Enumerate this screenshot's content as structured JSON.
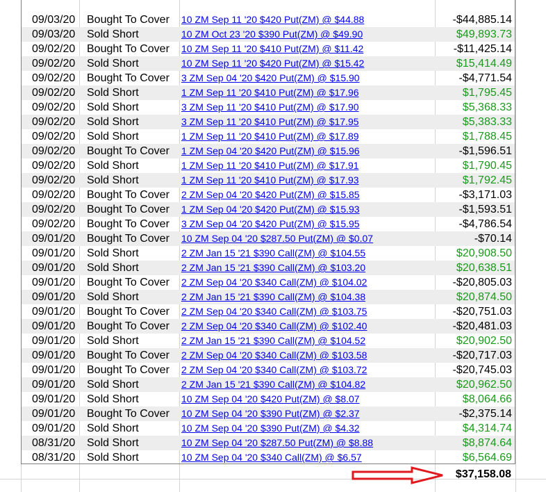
{
  "colors": {
    "positive": "#1a9a1a",
    "negative": "#000000",
    "link": "#0000ee",
    "arrow": "#e0191f"
  },
  "rows": [
    {
      "date": "09/03/20",
      "action": "Bought To Cover",
      "desc": "10 ZM Sep 11 '20 $420 Put(ZM) @ $44.88",
      "amount": "-$44,885.14",
      "positive": false
    },
    {
      "date": "09/03/20",
      "action": "Sold Short",
      "desc": "10 ZM Oct 23 '20 $390 Put(ZM) @ $49.90",
      "amount": "$49,893.73",
      "positive": true
    },
    {
      "date": "09/02/20",
      "action": "Bought To Cover",
      "desc": "10 ZM Sep 11 '20 $410 Put(ZM) @ $11.42",
      "amount": "-$11,425.14",
      "positive": false
    },
    {
      "date": "09/02/20",
      "action": "Sold Short",
      "desc": "10 ZM Sep 11 '20 $420 Put(ZM) @ $15.42",
      "amount": "$15,414.49",
      "positive": true
    },
    {
      "date": "09/02/20",
      "action": "Bought To Cover",
      "desc": "3 ZM Sep 04 '20 $420 Put(ZM) @ $15.90",
      "amount": "-$4,771.54",
      "positive": false
    },
    {
      "date": "09/02/20",
      "action": "Sold Short",
      "desc": "1 ZM Sep 11 '20 $410 Put(ZM) @ $17.96",
      "amount": "$1,795.45",
      "positive": true
    },
    {
      "date": "09/02/20",
      "action": "Sold Short",
      "desc": "3 ZM Sep 11 '20 $410 Put(ZM) @ $17.90",
      "amount": "$5,368.33",
      "positive": true
    },
    {
      "date": "09/02/20",
      "action": "Sold Short",
      "desc": "3 ZM Sep 11 '20 $410 Put(ZM) @ $17.95",
      "amount": "$5,383.33",
      "positive": true
    },
    {
      "date": "09/02/20",
      "action": "Sold Short",
      "desc": "1 ZM Sep 11 '20 $410 Put(ZM) @ $17.89",
      "amount": "$1,788.45",
      "positive": true
    },
    {
      "date": "09/02/20",
      "action": "Bought To Cover",
      "desc": "1 ZM Sep 04 '20 $420 Put(ZM) @ $15.96",
      "amount": "-$1,596.51",
      "positive": false
    },
    {
      "date": "09/02/20",
      "action": "Sold Short",
      "desc": "1 ZM Sep 11 '20 $410 Put(ZM) @ $17.91",
      "amount": "$1,790.45",
      "positive": true
    },
    {
      "date": "09/02/20",
      "action": "Sold Short",
      "desc": "1 ZM Sep 11 '20 $410 Put(ZM) @ $17.93",
      "amount": "$1,792.45",
      "positive": true
    },
    {
      "date": "09/02/20",
      "action": "Bought To Cover",
      "desc": "2 ZM Sep 04 '20 $420 Put(ZM) @ $15.85",
      "amount": "-$3,171.03",
      "positive": false
    },
    {
      "date": "09/02/20",
      "action": "Bought To Cover",
      "desc": "1 ZM Sep 04 '20 $420 Put(ZM) @ $15.93",
      "amount": "-$1,593.51",
      "positive": false
    },
    {
      "date": "09/02/20",
      "action": "Bought To Cover",
      "desc": "3 ZM Sep 04 '20 $420 Put(ZM) @ $15.95",
      "amount": "-$4,786.54",
      "positive": false
    },
    {
      "date": "09/01/20",
      "action": "Bought To Cover",
      "desc": "10 ZM Sep 04 '20 $287.50 Put(ZM) @ $0.07",
      "amount": "-$70.14",
      "positive": false
    },
    {
      "date": "09/01/20",
      "action": "Sold Short",
      "desc": "2 ZM Jan 15 '21 $390 Call(ZM) @ $104.55",
      "amount": "$20,908.50",
      "positive": true
    },
    {
      "date": "09/01/20",
      "action": "Sold Short",
      "desc": "2 ZM Jan 15 '21 $390 Call(ZM) @ $103.20",
      "amount": "$20,638.51",
      "positive": true
    },
    {
      "date": "09/01/20",
      "action": "Bought To Cover",
      "desc": "2 ZM Sep 04 '20 $340 Call(ZM) @ $104.02",
      "amount": "-$20,805.03",
      "positive": false
    },
    {
      "date": "09/01/20",
      "action": "Sold Short",
      "desc": "2 ZM Jan 15 '21 $390 Call(ZM) @ $104.38",
      "amount": "$20,874.50",
      "positive": true
    },
    {
      "date": "09/01/20",
      "action": "Bought To Cover",
      "desc": "2 ZM Sep 04 '20 $340 Call(ZM) @ $103.75",
      "amount": "-$20,751.03",
      "positive": false
    },
    {
      "date": "09/01/20",
      "action": "Bought To Cover",
      "desc": "2 ZM Sep 04 '20 $340 Call(ZM) @ $102.40",
      "amount": "-$20,481.03",
      "positive": false
    },
    {
      "date": "09/01/20",
      "action": "Sold Short",
      "desc": "2 ZM Jan 15 '21 $390 Call(ZM) @ $104.52",
      "amount": "$20,902.50",
      "positive": true
    },
    {
      "date": "09/01/20",
      "action": "Bought To Cover",
      "desc": "2 ZM Sep 04 '20 $340 Call(ZM) @ $103.58",
      "amount": "-$20,717.03",
      "positive": false
    },
    {
      "date": "09/01/20",
      "action": "Bought To Cover",
      "desc": "2 ZM Sep 04 '20 $340 Call(ZM) @ $103.72",
      "amount": "-$20,745.03",
      "positive": false
    },
    {
      "date": "09/01/20",
      "action": "Sold Short",
      "desc": "2 ZM Jan 15 '21 $390 Call(ZM) @ $104.82",
      "amount": "$20,962.50",
      "positive": true
    },
    {
      "date": "09/01/20",
      "action": "Sold Short",
      "desc": "10 ZM Sep 04 '20 $420 Put(ZM) @ $8.07",
      "amount": "$8,064.66",
      "positive": true
    },
    {
      "date": "09/01/20",
      "action": "Bought To Cover",
      "desc": "10 ZM Sep 04 '20 $390 Put(ZM) @ $2.37",
      "amount": "-$2,375.14",
      "positive": false
    },
    {
      "date": "09/01/20",
      "action": "Sold Short",
      "desc": "10 ZM Sep 04 '20 $390 Put(ZM) @ $4.32",
      "amount": "$4,314.74",
      "positive": true
    },
    {
      "date": "08/31/20",
      "action": "Sold Short",
      "desc": "10 ZM Sep 04 '20 $287.50 Put(ZM) @ $8.88",
      "amount": "$8,874.64",
      "positive": true
    },
    {
      "date": "08/31/20",
      "action": "Sold Short",
      "desc": "10 ZM Sep 04 '20 $340 Call(ZM) @ $6.57",
      "amount": "$6,564.69",
      "positive": true
    }
  ],
  "total": "$37,158.08",
  "arrow_icon": "right-arrow-icon"
}
